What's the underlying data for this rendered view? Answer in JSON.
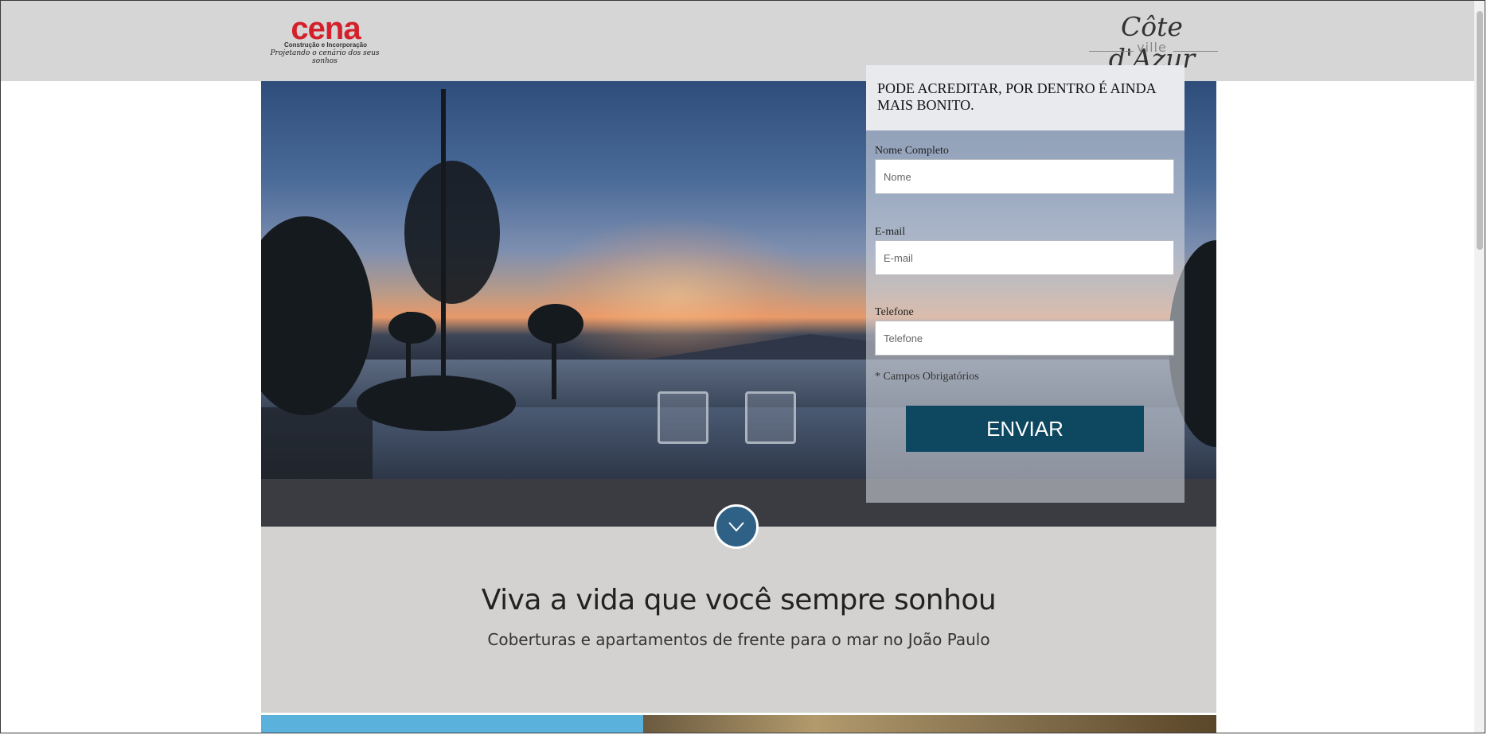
{
  "header": {
    "left_logo": {
      "wordmark": "cena",
      "subtitle": "Construção e Incorporação",
      "tagline": "Projetando o cenário dos seus sonhos"
    },
    "right_logo": {
      "script": "Côte d'Azur",
      "ville": "ville"
    }
  },
  "form": {
    "heading": "PODE ACREDITAR, POR DENTRO É AINDA MAIS BONITO.",
    "fields": [
      {
        "label": "Nome Completo",
        "placeholder": "Nome"
      },
      {
        "label": "E-mail",
        "placeholder": "E-mail"
      },
      {
        "label": "Telefone",
        "placeholder": "Telefone"
      }
    ],
    "required_note": "* Campos Obrigatórios",
    "submit_label": "ENVIAR"
  },
  "scroll_button": {
    "icon": "chevron-down-icon"
  },
  "info": {
    "title": "Viva a vida que você sempre sonhou",
    "subtitle": "Coberturas e apartamentos de frente para o mar no João Paulo"
  },
  "colors": {
    "header_bg": "#d6d6d6",
    "brand_red": "#d4202a",
    "button_bg": "#0e4760",
    "scroll_circle": "#2f6187",
    "info_bg": "#d3d2d1",
    "strip_blue": "#5ab2dc"
  }
}
